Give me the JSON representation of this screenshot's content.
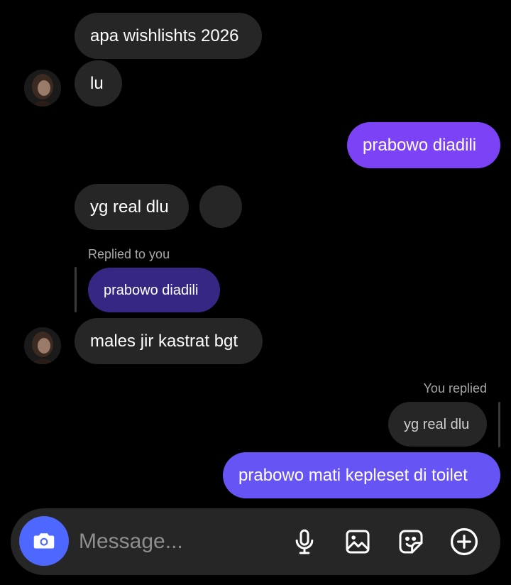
{
  "conversation": {
    "messages": [
      {
        "text": "apa wishlishts 2026"
      },
      {
        "text": "lu"
      },
      {
        "text": "prabowo diadili"
      },
      {
        "text": "yg real dlu"
      },
      {
        "text": "males jir kastrat bgt"
      },
      {
        "text": "prabowo mati kepleset di toilet"
      }
    ],
    "incoming_reply": {
      "caption": "Replied to you",
      "quoted_text": "prabowo diadili"
    },
    "outgoing_reply": {
      "caption": "You replied",
      "quoted_text": "yg real dlu"
    }
  },
  "composer": {
    "placeholder": "Message...",
    "value": "",
    "icons": {
      "camera": "camera-icon",
      "microphone": "microphone-icon",
      "gallery": "gallery-icon",
      "sticker": "sticker-icon",
      "add": "plus-circle-icon"
    }
  },
  "colors": {
    "background": "#000000",
    "incoming_bubble": "#262626",
    "outgoing_bubble": "#7b42f6",
    "outgoing_bubble_latest": "#6654f5",
    "quoted_outgoing": "#362785",
    "camera_button": "#4d67ff",
    "composer": "#262626"
  }
}
